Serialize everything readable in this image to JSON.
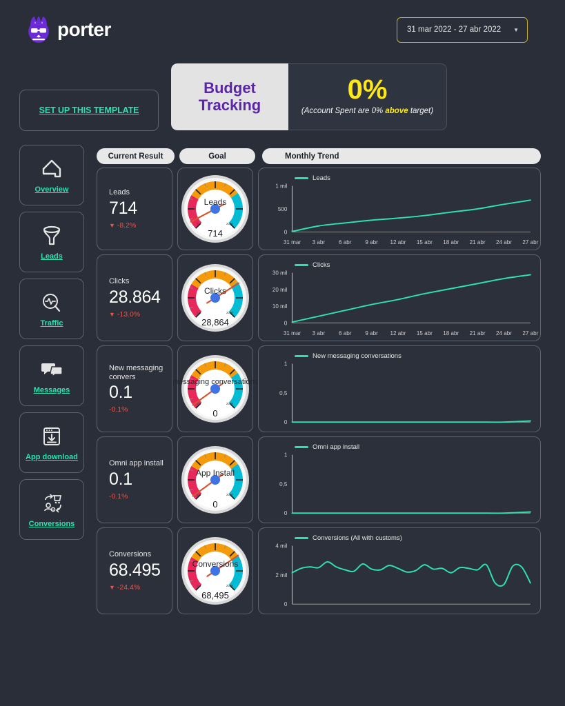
{
  "header": {
    "brand": "porter",
    "logo_icon": "porter-cat-logo",
    "date_range": "31 mar 2022 - 27 abr 2022",
    "caret_icon": "chevron-down-icon"
  },
  "budget": {
    "title_line1": "Budget",
    "title_line2": "Tracking",
    "percent": "0%",
    "note_prefix": "(Account Spent are 0% ",
    "note_highlight": "above",
    "note_suffix": " target)"
  },
  "setup": {
    "label": "SET UP THIS TEMPLATE"
  },
  "sidebar": {
    "items": [
      {
        "label": "Overview",
        "icon": "home-icon"
      },
      {
        "label": "Leads",
        "icon": "funnel-icon"
      },
      {
        "label": "Traffic",
        "icon": "magnifier-pulse-icon"
      },
      {
        "label": "Messages",
        "icon": "chat-bubbles-icon"
      },
      {
        "label": "App download",
        "icon": "browser-download-icon"
      },
      {
        "label": "Conversions",
        "icon": "cart-user-icon"
      }
    ]
  },
  "columns": {
    "current_result": "Current Result",
    "goal": "Goal",
    "monthly_trend": "Monthly Trend"
  },
  "colors": {
    "accent": "#2fe0b0",
    "background": "#292e38",
    "panel": "#2b303a",
    "gauge_orange": "#f59b0b",
    "gauge_teal": "#00bcd4",
    "gauge_crimson": "#e8285a",
    "needle": "#d4552e",
    "hub": "#3f73e3",
    "budget_yellow": "#ffe81a",
    "budget_purple": "#5b27a8",
    "delta_negative": "#e2584f",
    "date_border": "#c9b32b"
  },
  "metrics": [
    {
      "name": "Leads",
      "value": "714",
      "delta": "-8.2%",
      "delta_arrow": "▼",
      "show_arrow": true,
      "gauge": {
        "title": "Leads",
        "readout": "714",
        "min": "0",
        "max": "2000",
        "needle_angle": -118
      }
    },
    {
      "name": "Clicks",
      "value": "28.864",
      "delta": "-13.0%",
      "delta_arrow": "▼",
      "show_arrow": true,
      "gauge": {
        "title": "Clicks",
        "readout": "28,864",
        "min": "0",
        "max": "2000",
        "needle_angle": 58
      }
    },
    {
      "name": "New messaging convers",
      "value": "0.1",
      "delta": "-0.1%",
      "delta_arrow": "",
      "show_arrow": false,
      "gauge": {
        "title": "messaging conversations",
        "readout": "0",
        "min": "0",
        "max": "2000",
        "needle_angle": -126
      }
    },
    {
      "name": "Omni app install",
      "value": "0.1",
      "delta": "-0.1%",
      "delta_arrow": "",
      "show_arrow": false,
      "gauge": {
        "title": "App Install",
        "readout": "0",
        "min": "0",
        "max": "2000",
        "needle_angle": -126
      }
    },
    {
      "name": "Conversions",
      "value": "68.495",
      "delta": "-24.4%",
      "delta_arrow": "▼",
      "show_arrow": true,
      "gauge": {
        "title": "Conversions",
        "readout": "68,495",
        "min": "0",
        "max": "2000",
        "needle_angle": 56
      }
    }
  ],
  "chart_data": [
    {
      "type": "line",
      "title": "Leads",
      "legend": "Leads",
      "xlabel": "",
      "ylabel": "",
      "ytick_labels": [
        "0",
        "500",
        "1 mil"
      ],
      "ylim": [
        0,
        1000
      ],
      "grid": false,
      "legend_position": "top-left",
      "xtick_labels": [
        "31 mar",
        "3 abr",
        "6 abr",
        "9 abr",
        "12 abr",
        "15 abr",
        "18 abr",
        "21 abr",
        "24 abr",
        "27 abr"
      ],
      "x": [
        0,
        1,
        2,
        3,
        4,
        5,
        6,
        7,
        8,
        9
      ],
      "values": [
        10,
        130,
        195,
        255,
        300,
        355,
        430,
        500,
        600,
        690
      ]
    },
    {
      "type": "line",
      "title": "Clicks",
      "legend": "Clicks",
      "xlabel": "",
      "ylabel": "",
      "ytick_labels": [
        "0",
        "10 mil",
        "20 mil",
        "30 mil"
      ],
      "ylim": [
        0,
        30
      ],
      "grid": false,
      "legend_position": "top-left",
      "xtick_labels": [
        "31 mar",
        "3 abr",
        "6 abr",
        "9 abr",
        "12 abr",
        "15 abr",
        "18 abr",
        "21 abr",
        "24 abr",
        "27 abr"
      ],
      "x": [
        0,
        1,
        2,
        3,
        4,
        5,
        6,
        7,
        8,
        9
      ],
      "values": [
        0.5,
        4.0,
        7.5,
        11.0,
        14.0,
        17.5,
        20.5,
        23.5,
        26.5,
        28.8
      ]
    },
    {
      "type": "line",
      "title": "New messaging conversations",
      "legend": "New messaging conversations",
      "xlabel": "",
      "ylabel": "",
      "ytick_labels": [
        "0",
        "0,5",
        "1"
      ],
      "ylim": [
        0,
        1
      ],
      "grid": false,
      "legend_position": "top-left",
      "xtick_labels": [],
      "x": [
        0,
        1,
        2,
        3,
        4,
        5,
        6,
        7,
        8,
        9
      ],
      "values": [
        0,
        0,
        0,
        0,
        0,
        0,
        0,
        0,
        0,
        0.02
      ]
    },
    {
      "type": "line",
      "title": "Omni app install",
      "legend": "Omni app install",
      "xlabel": "",
      "ylabel": "",
      "ytick_labels": [
        "0",
        "0,5",
        "1"
      ],
      "ylim": [
        0,
        1
      ],
      "grid": false,
      "legend_position": "top-left",
      "xtick_labels": [],
      "x": [
        0,
        1,
        2,
        3,
        4,
        5,
        6,
        7,
        8,
        9
      ],
      "values": [
        0,
        0,
        0,
        0,
        0,
        0,
        0,
        0,
        0,
        0.02
      ]
    },
    {
      "type": "line",
      "title": "Conversions (All with customs)",
      "legend": "Conversions (All with customs)",
      "xlabel": "",
      "ylabel": "",
      "ytick_labels": [
        "0",
        "2 mil",
        "4 mil"
      ],
      "ylim": [
        0,
        4
      ],
      "grid": false,
      "legend_position": "top-left",
      "xtick_labels": [],
      "x": [
        0,
        1,
        2,
        3,
        4,
        5,
        6,
        7,
        8,
        9,
        10,
        11,
        12,
        13,
        14,
        15,
        16,
        17,
        18,
        19,
        20,
        21,
        22,
        23,
        24,
        25,
        26,
        27
      ],
      "values": [
        2.15,
        2.45,
        2.55,
        2.5,
        2.9,
        2.55,
        2.35,
        2.25,
        2.75,
        2.4,
        2.35,
        2.65,
        2.45,
        2.2,
        2.3,
        2.7,
        2.4,
        2.45,
        2.15,
        2.5,
        2.45,
        2.35,
        2.7,
        1.45,
        1.35,
        2.6,
        2.55,
        1.45
      ]
    }
  ]
}
